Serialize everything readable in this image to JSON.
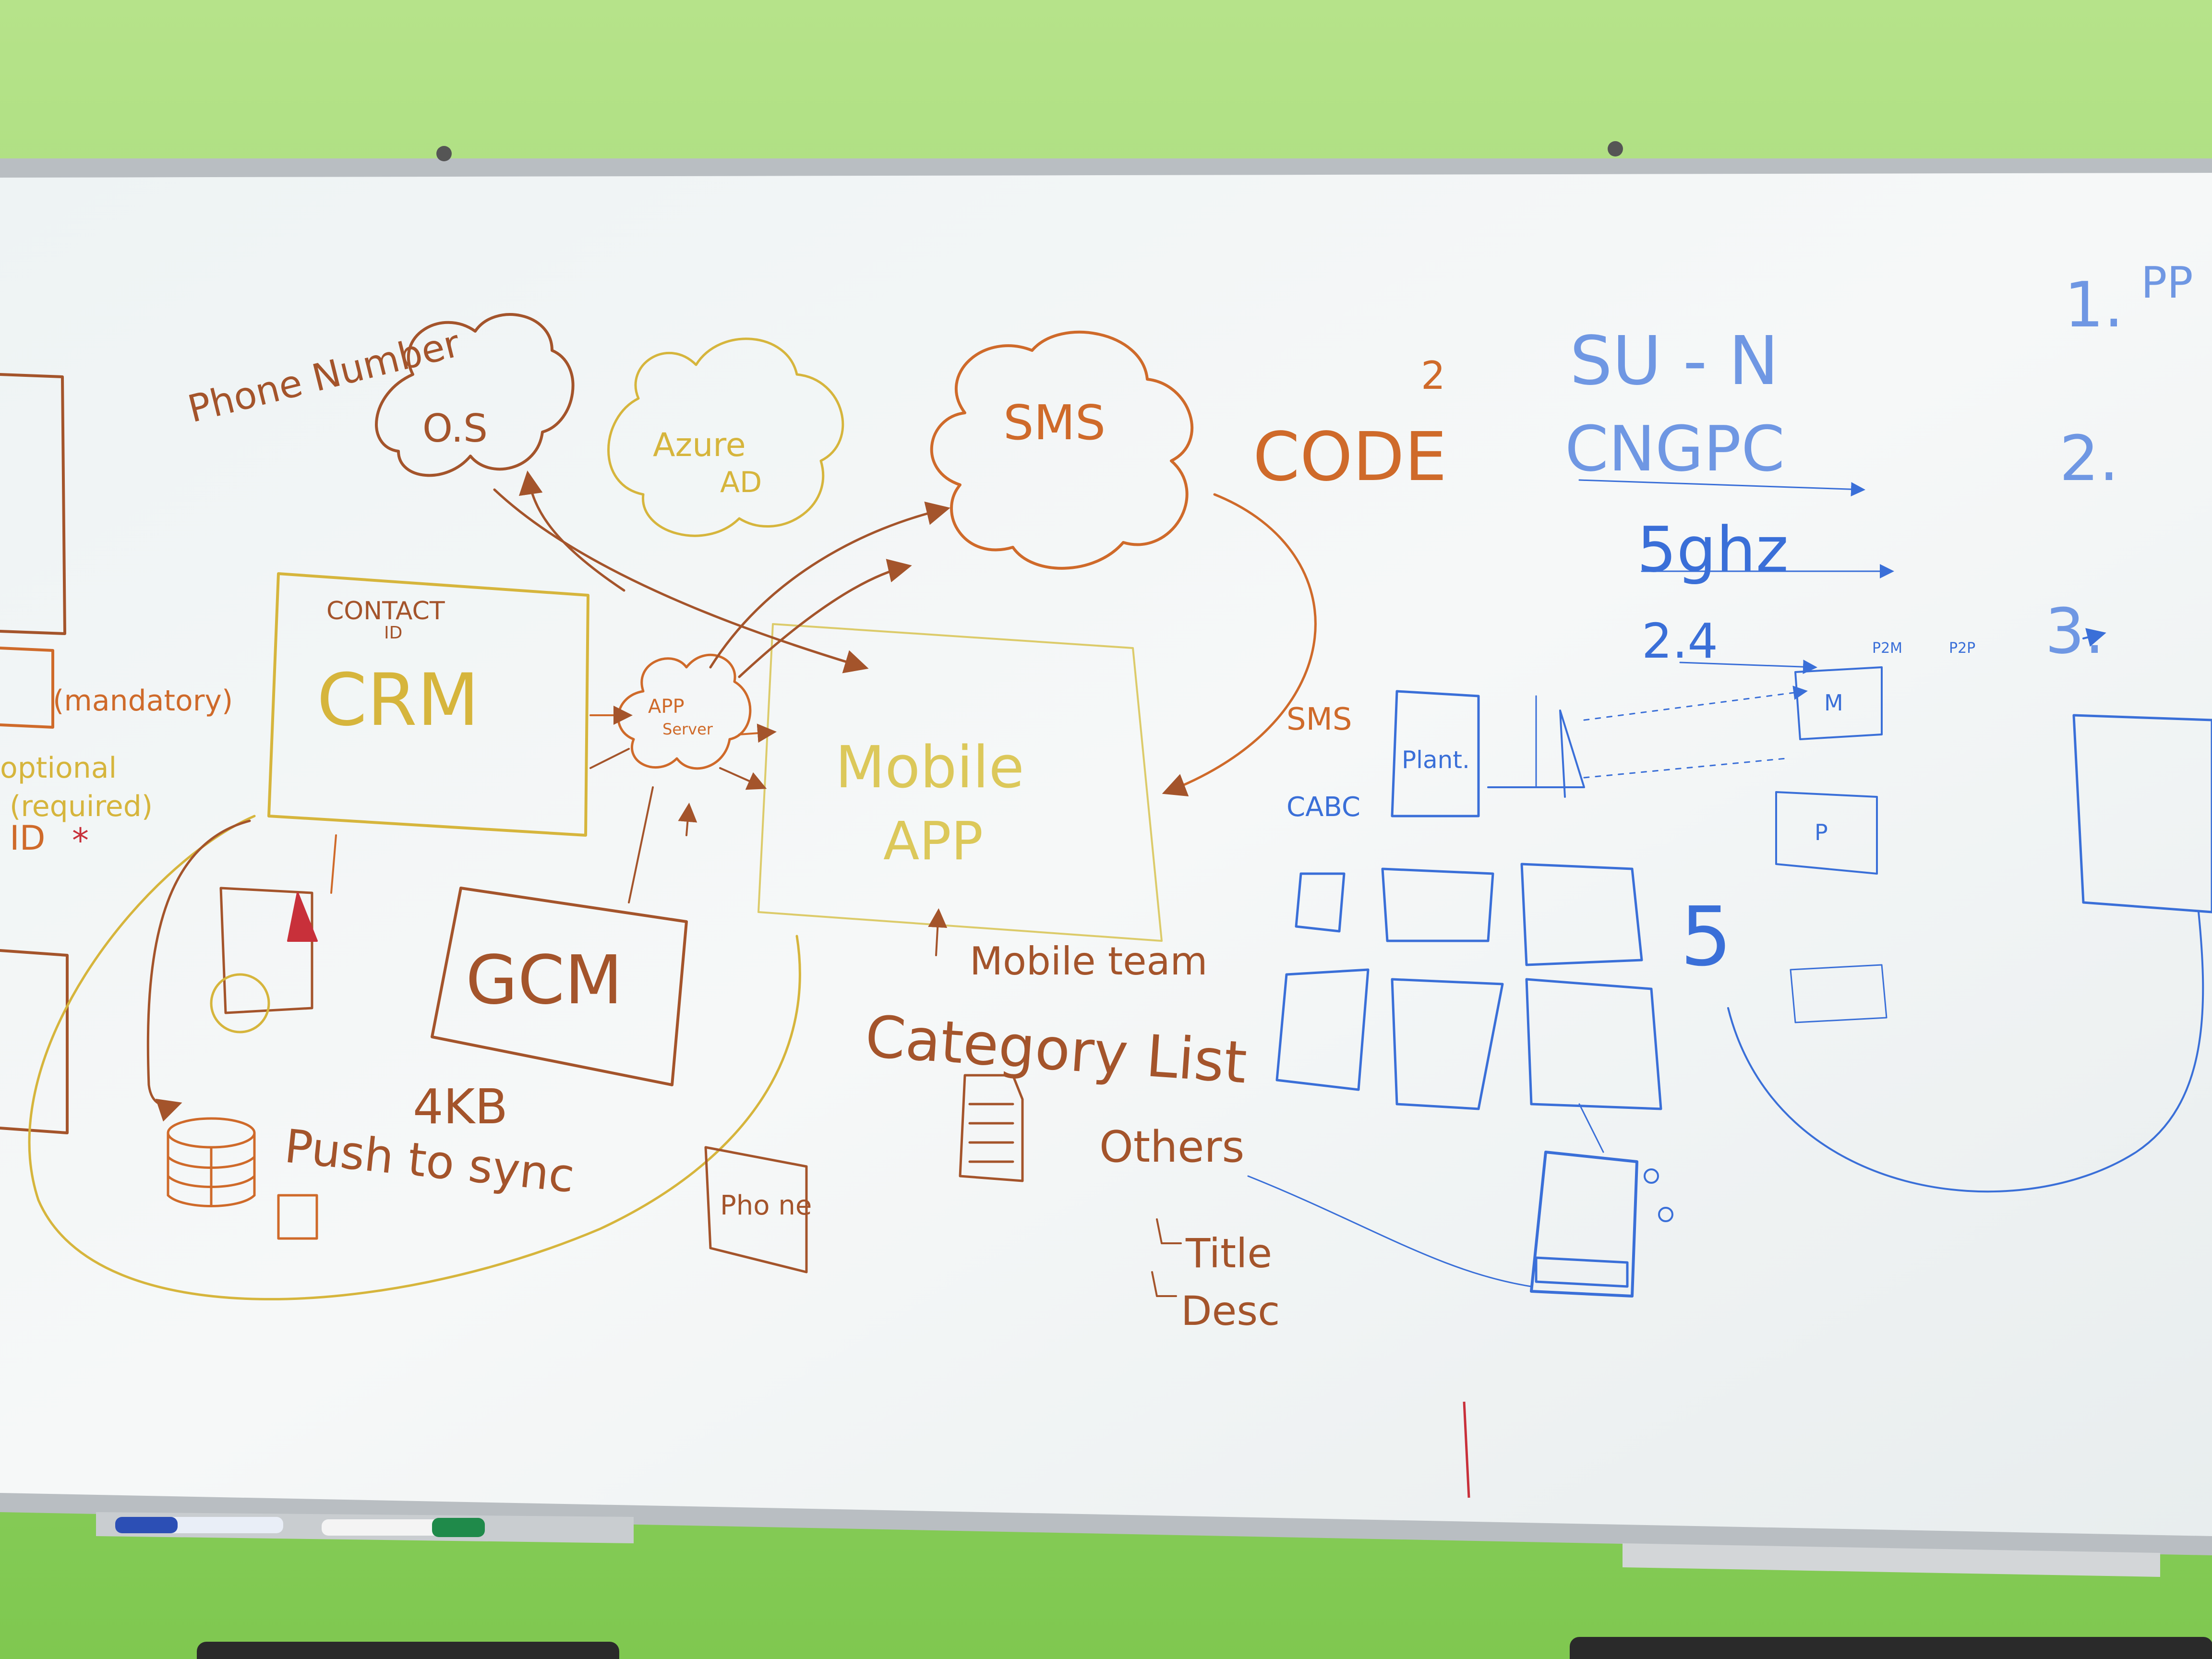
{
  "colors": {
    "wall_top": "#b6e38a",
    "wall_bottom": "#7fc850",
    "board": "#f2f5f5",
    "frame": "#b9bec2",
    "marker_orange": "#cf6a2a",
    "marker_brown": "#a4542b",
    "marker_yellow": "#d6b53c",
    "marker_blue": "#3a6fd8",
    "marker_red": "#c8303a",
    "chair": "#2a2a2a"
  },
  "icons": [
    "cloud-icon",
    "database-icon",
    "document-icon",
    "phone-icon",
    "arrow-icon"
  ],
  "board": {
    "left": {
      "phone_number": "Phone Number",
      "os_cloud": "O.S",
      "azure_ad": [
        "Azure",
        "AD"
      ],
      "sms_cloud": "SMS",
      "contact_id": [
        "CONTACT",
        "ID"
      ],
      "crm": "CRM",
      "app_server": [
        "APP",
        "Server"
      ],
      "mobile_app": [
        "Mobile",
        "APP"
      ],
      "gcm": "GCM",
      "size_4kb": "4KB",
      "push_to_sync": "Push to sync",
      "mobile_team": "Mobile team",
      "category_list": "Category List",
      "others": "Others",
      "title": "Title",
      "desc": "Desc",
      "phone_doc": "Pho ne",
      "mandatory": "(mandatory)",
      "optional": "optional",
      "required": "(required)",
      "id_star": "ID"
    },
    "center": {
      "code_num": "2",
      "code": "CODE",
      "sms": "SMS",
      "cabc": "CABC",
      "plant": "Plant.",
      "five": "5",
      "module_label": "M",
      "sub_label": "P",
      "p2m": "P2M",
      "p2p": "P2P"
    },
    "right": {
      "su_n": "SU - N",
      "cngpc": "CNGPC",
      "ghz5": "5ghz",
      "ghz24": "2.4",
      "item1": "1.",
      "item1_text": "PP",
      "item2": "2.",
      "item3": "3."
    }
  }
}
